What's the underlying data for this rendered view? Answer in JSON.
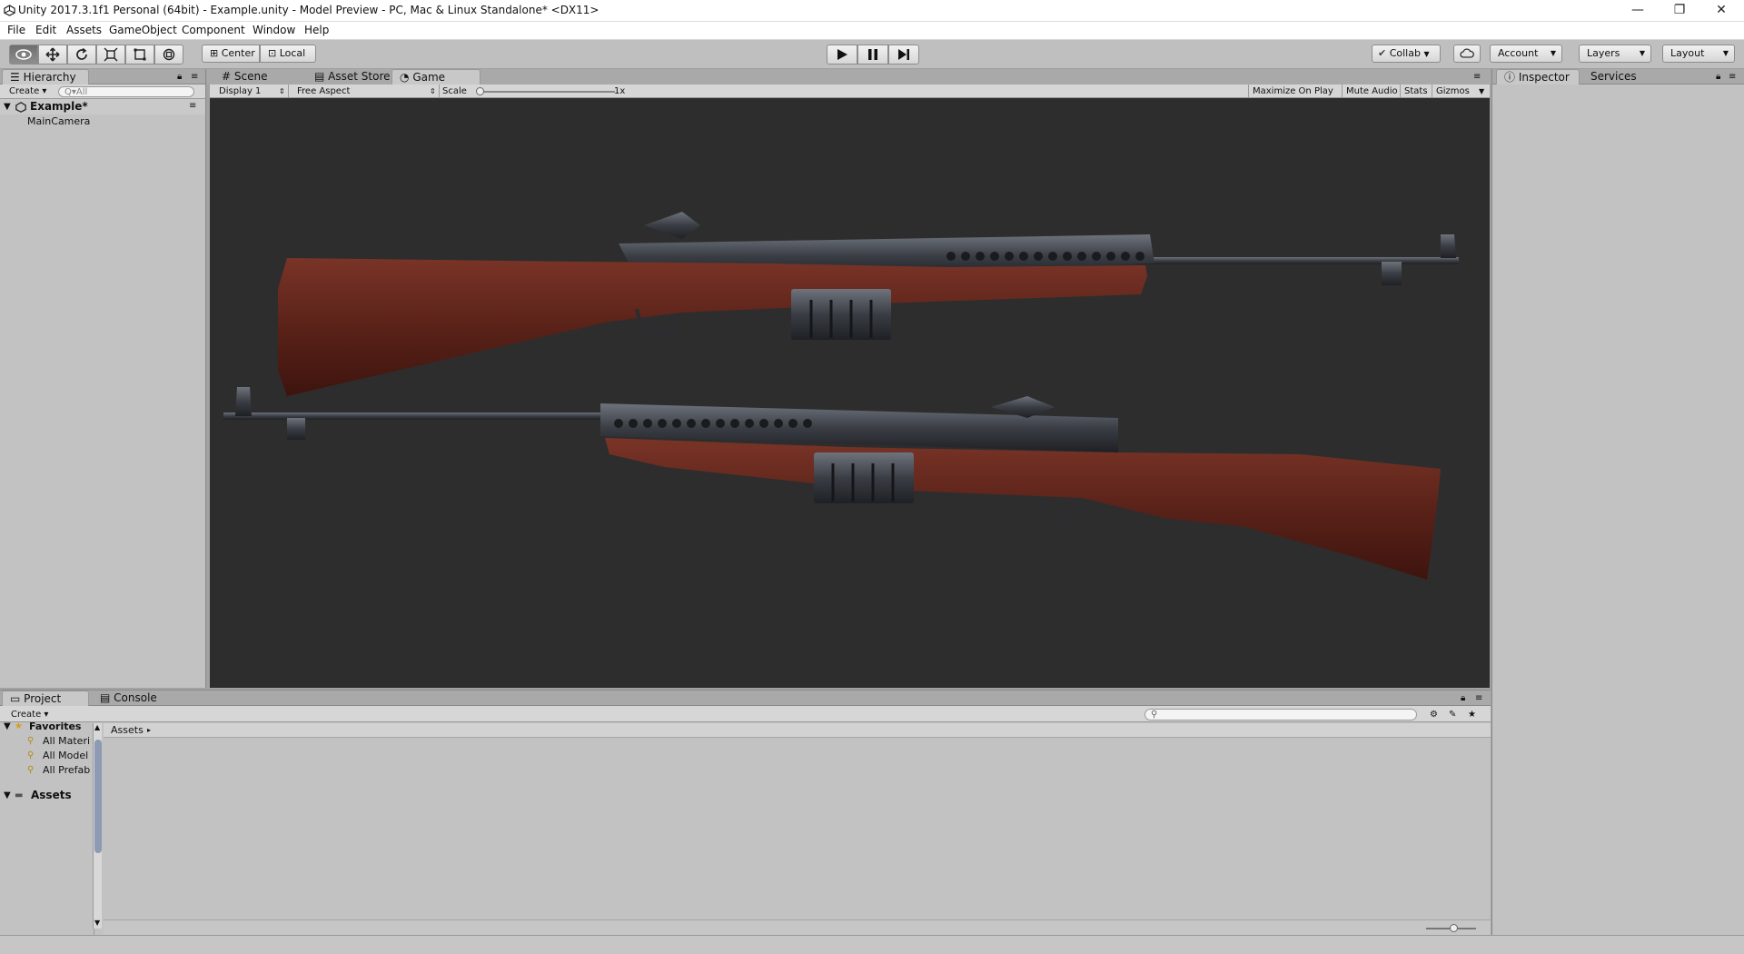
{
  "window": {
    "title": "Unity 2017.3.1f1 Personal (64bit) - Example.unity - Model Preview - PC, Mac & Linux Standalone* <DX11>"
  },
  "menu": [
    "File",
    "Edit",
    "Assets",
    "GameObject",
    "Component",
    "Window",
    "Help"
  ],
  "toolbar": {
    "center_label": "Center",
    "local_label": "Local",
    "collab_label": "Collab",
    "account_label": "Account",
    "layers_label": "Layers",
    "layout_label": "Layout"
  },
  "hierarchy": {
    "tab_label": "Hierarchy",
    "create_label": "Create",
    "search_placeholder": "Q▾All",
    "scene_name": "Example*",
    "items": [
      "MainCamera"
    ]
  },
  "view_tabs": {
    "scene": "Scene",
    "asset_store": "Asset Store",
    "game": "Game"
  },
  "game_bar": {
    "display": "Display 1",
    "aspect": "Free Aspect",
    "scale_label": "Scale",
    "scale_value": "1x",
    "maximize": "Maximize On Play",
    "mute": "Mute Audio",
    "stats": "Stats",
    "gizmos": "Gizmos"
  },
  "inspector": {
    "tab_label": "Inspector",
    "services_label": "Services"
  },
  "project": {
    "tab_label": "Project",
    "console_label": "Console",
    "create_label": "Create",
    "favorites_label": "Favorites",
    "favorites": [
      "All Materi",
      "All Model",
      "All Prefab"
    ],
    "assets_label": "Assets",
    "breadcrumb": "Assets"
  },
  "colors": {
    "wood": "#5a2219",
    "metal": "#3a3d44",
    "viewport": "#2d2d2d",
    "accent": "#3d6db3"
  }
}
